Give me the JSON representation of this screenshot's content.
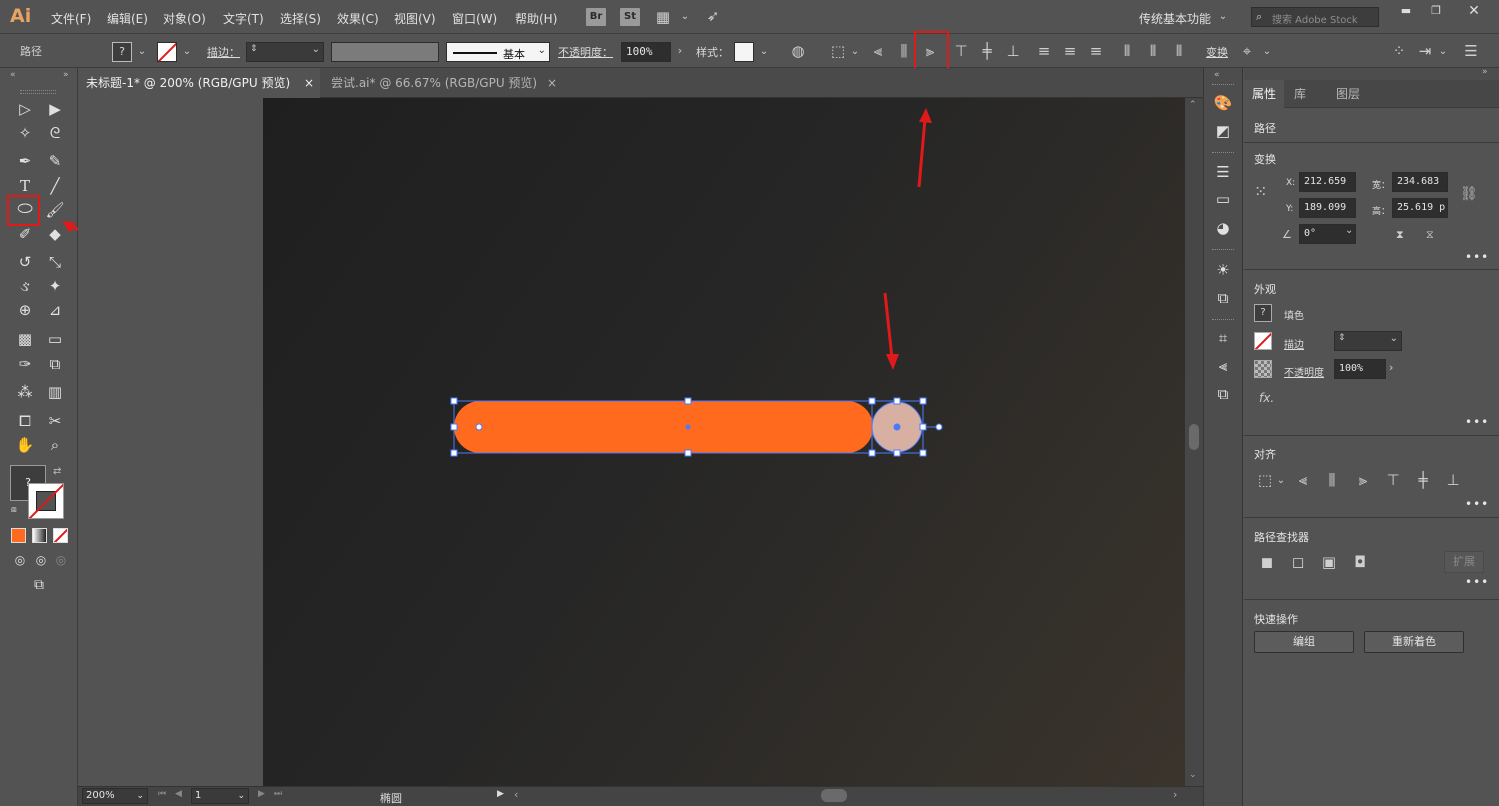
{
  "app": {
    "logo": "Ai"
  },
  "menu": [
    "文件(F)",
    "编辑(E)",
    "对象(O)",
    "文字(T)",
    "选择(S)",
    "效果(C)",
    "视图(V)",
    "窗口(W)",
    "帮助(H)"
  ],
  "bridge_buttons": [
    "Br",
    "St"
  ],
  "workspace": "传统基本功能",
  "search_placeholder": "搜索 Adobe Stock",
  "control": {
    "object_type": "路径",
    "fill_label": "?",
    "stroke_label": "描边：",
    "brush_label": "基本",
    "opacity_label": "不透明度：",
    "opacity_value": "100%",
    "style_label": "样式：",
    "transform_label": "变换"
  },
  "tabs": [
    {
      "label": "未标题-1* @ 200% (RGB/GPU 预览)",
      "close": "×"
    },
    {
      "label": "尝试.ai* @ 66.67% (RGB/GPU 预览)",
      "close": "×"
    }
  ],
  "status": {
    "zoom": "200%",
    "page": "1",
    "tool_name": "椭圆"
  },
  "swatch": {
    "question": "?"
  },
  "panel": {
    "tabs": [
      "属性",
      "库",
      "图层"
    ],
    "selection_type": "路径",
    "transform_title": "变换",
    "x_label": "X:",
    "x_value": "212.659",
    "y_label": "Y:",
    "y_value": "189.099",
    "w_label": "宽：",
    "w_value": "234.683",
    "h_label": "高：",
    "h_value": "25.619 p",
    "angle_value": "0°",
    "appearance_title": "外观",
    "fill_label": "填色",
    "fill_q": "?",
    "stroke_label": "描边",
    "opacity_label": "不透明度",
    "opacity_value": "100%",
    "fx_label": "fx.",
    "align_title": "对齐",
    "pathfinder_title": "路径查找器",
    "expand_label": "扩展",
    "quick_title": "快速操作",
    "group_btn": "编组",
    "recolor_btn": "重新着色",
    "more": "•••"
  },
  "colors": {
    "accent_orange": "#ff6a1e",
    "circle_fill": "#d8b0a2",
    "selection_blue": "#4a7bff",
    "annotation_red": "#e01919"
  }
}
